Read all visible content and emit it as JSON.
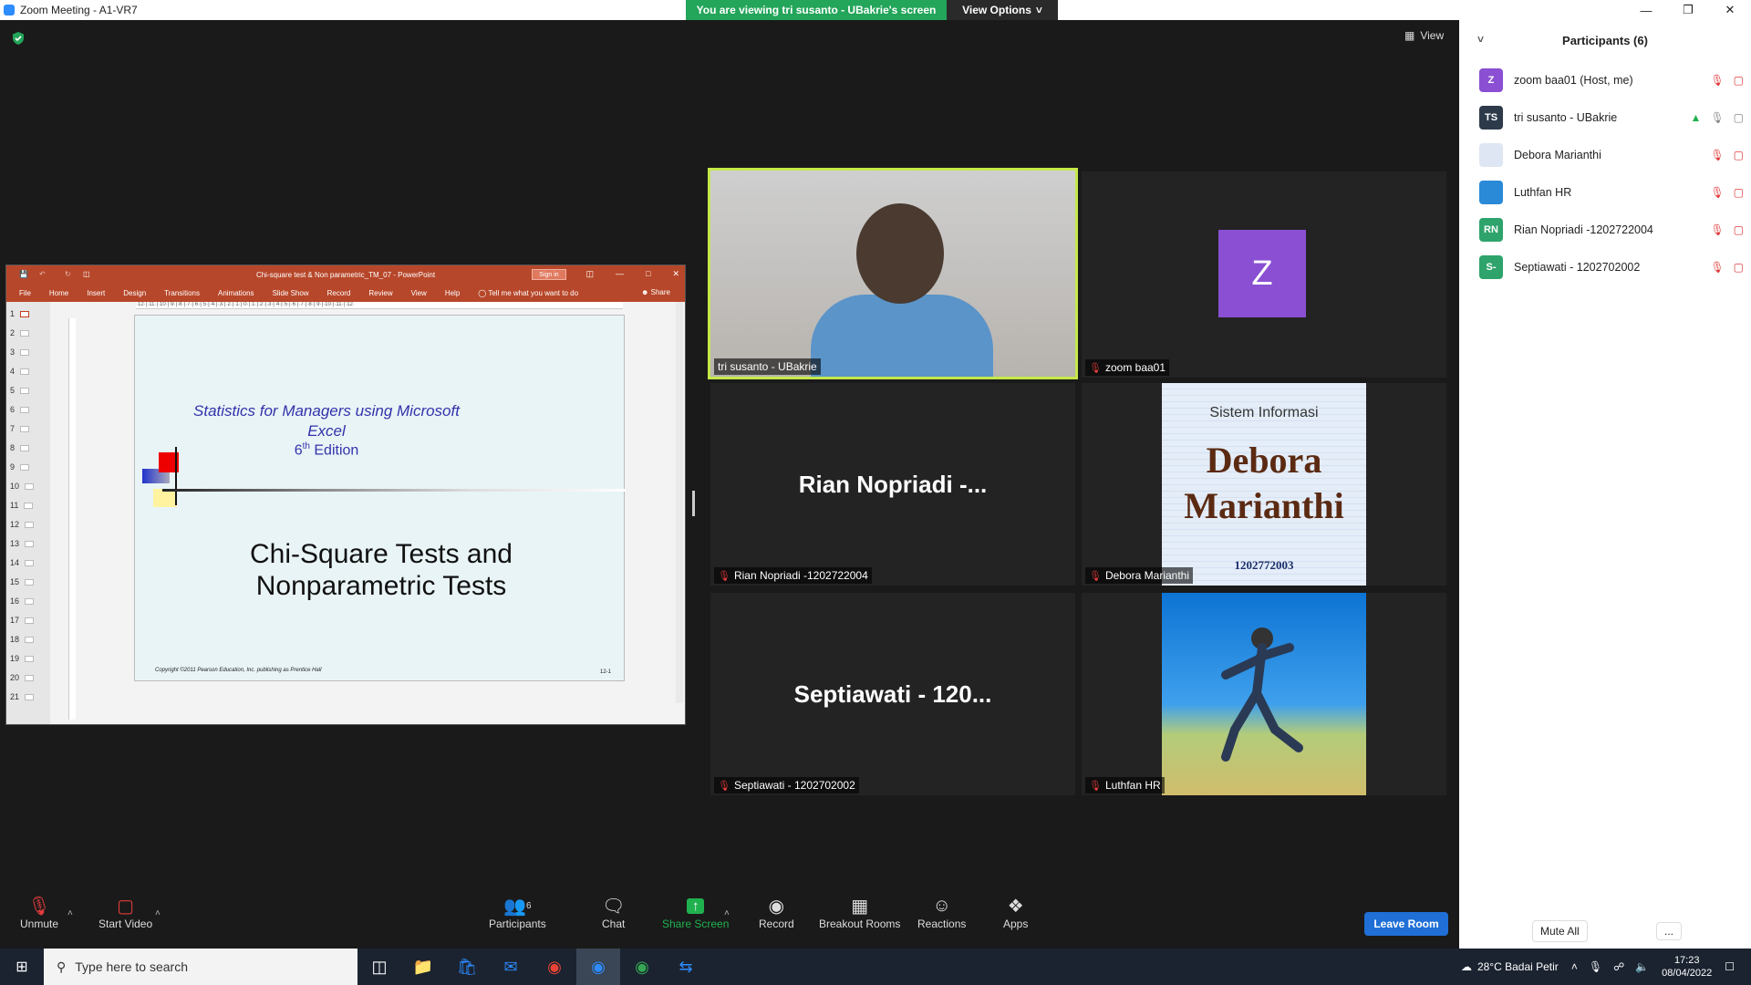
{
  "window": {
    "title": "Zoom Meeting - A1-VR7"
  },
  "banner": {
    "viewing_text": "You are viewing tri susanto - UBakrie's screen",
    "view_options": "View Options"
  },
  "view_button": "View",
  "powerpoint": {
    "title": "Chi-square test & Non parametric_TM_07 - PowerPoint",
    "sign_in": "Sign in",
    "menu": [
      "File",
      "Home",
      "Insert",
      "Design",
      "Transitions",
      "Animations",
      "Slide Show",
      "Record",
      "Review",
      "View",
      "Help",
      "Tell me what you want to do"
    ],
    "share": "Share",
    "ruler_text": "·12·|·11·|·10·|·9·|·8·|·7·|·6·|·5·|·4·|·3·|·2·|·1·|·0·|·1·|·2·|·3·|·4·|·5·|·6·|·7·|·8·|·9·|·10·|·11·|·12·",
    "slide_numbers": [
      "1",
      "2",
      "3",
      "4",
      "5",
      "6",
      "7",
      "8",
      "9",
      "10",
      "11",
      "12",
      "13",
      "14",
      "15",
      "16",
      "17",
      "18",
      "19",
      "20",
      "21"
    ],
    "slide": {
      "subtitle_line1": "Statistics for Managers using Microsoft",
      "subtitle_line2": "Excel",
      "edition_num": "6",
      "edition_sup": "th",
      "edition_word": " Edition",
      "title_line1": "Chi-Square Tests and",
      "title_line2": "Nonparametric Tests",
      "copyright": "Copyright ©2011 Pearson Education, Inc. publishing as Prentice Hall",
      "page": "12-1"
    }
  },
  "tiles": {
    "tri": {
      "name": "tri susanto - UBakrie"
    },
    "zoom": {
      "name": "zoom baa01",
      "initial": "Z"
    },
    "rian": {
      "name": "Rian Nopriadi -1202722004",
      "display": "Rian Nopriadi -..."
    },
    "debora": {
      "name": "Debora Marianthi",
      "poster_line1": "Sistem Informasi",
      "poster_line2": "Debora",
      "poster_line3": "Marianthi",
      "poster_line4": "1202772003"
    },
    "septi": {
      "name": "Septiawati - 1202702002",
      "display": "Septiawati - 120..."
    },
    "luthfan": {
      "name": "Luthfan HR"
    }
  },
  "participants": {
    "header": "Participants (6)",
    "list": [
      {
        "initials": "Z",
        "name": "zoom baa01 (Host, me)",
        "color": "#8a4fd2"
      },
      {
        "initials": "TS",
        "name": "tri susanto - UBakrie",
        "color": "#2d3a4a"
      },
      {
        "initials": "",
        "name": "Debora Marianthi",
        "color": "#dde6f2"
      },
      {
        "initials": "",
        "name": "Luthfan HR",
        "color": "#2a8ad8"
      },
      {
        "initials": "RN",
        "name": "Rian Nopriadi -1202722004",
        "color": "#2ea36b"
      },
      {
        "initials": "S-",
        "name": "Septiawati - 1202702002",
        "color": "#2ea36b"
      }
    ],
    "mute_all": "Mute All",
    "more": "..."
  },
  "toolbar": {
    "unmute": "Unmute",
    "start_video": "Start Video",
    "participants": "Participants",
    "participants_count": "6",
    "chat": "Chat",
    "share_screen": "Share Screen",
    "record": "Record",
    "breakout": "Breakout Rooms",
    "reactions": "Reactions",
    "apps": "Apps",
    "leave": "Leave Room"
  },
  "taskbar": {
    "search_placeholder": "Type here to search",
    "weather": "28°C  Badai Petir",
    "time": "17:23",
    "date": "08/04/2022"
  },
  "colors": {
    "zoom_blue": "#2d8cff",
    "banner_green": "#23a55a",
    "ppt_red": "#b7472a",
    "speaker_border": "#c5e84a",
    "leave_blue": "#1f6fd6"
  }
}
